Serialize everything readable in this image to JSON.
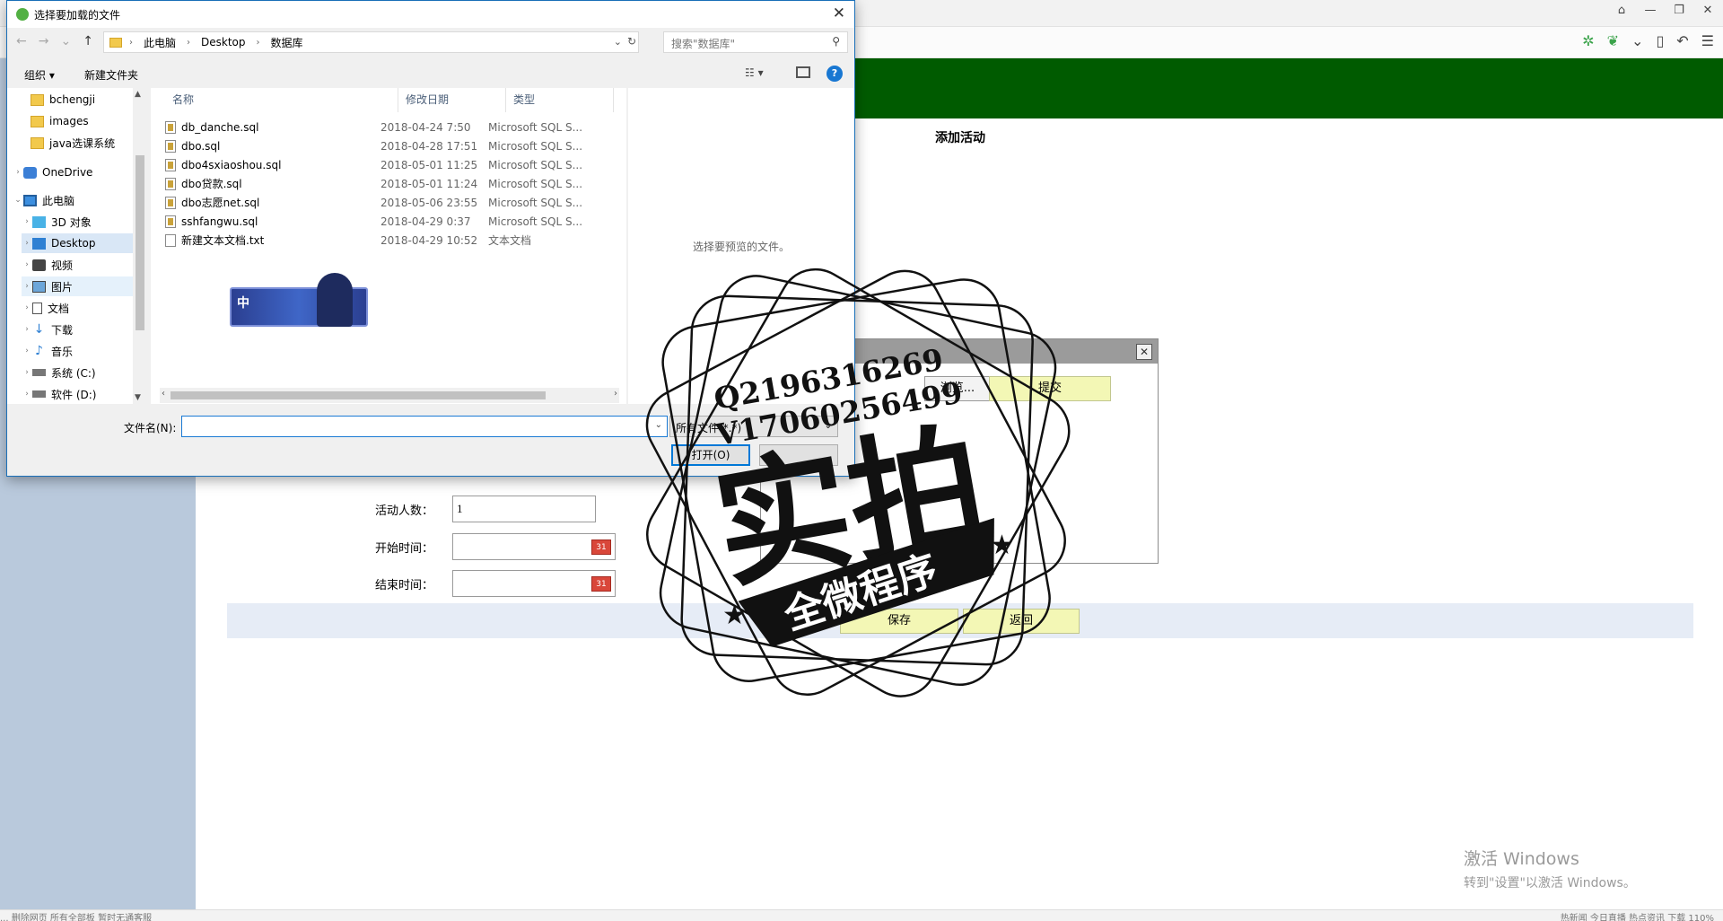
{
  "dialog": {
    "title": "选择要加载的文件",
    "breadcrumb": [
      "此电脑",
      "Desktop",
      "数据库"
    ],
    "search_placeholder": "搜索\"数据库\"",
    "organize_label": "组织 ▾",
    "new_folder_label": "新建文件夹",
    "nav_items": [
      {
        "label": "bchengji",
        "icon": "folder-icon"
      },
      {
        "label": "images",
        "icon": "folder-icon"
      },
      {
        "label": "java选课系统",
        "icon": "folder-icon"
      },
      {
        "label": "OneDrive",
        "icon": "onedrive-icon"
      },
      {
        "label": "此电脑",
        "icon": "computer-icon"
      },
      {
        "label": "3D 对象",
        "icon": "3d-objects-icon"
      },
      {
        "label": "Desktop",
        "icon": "desktop-icon"
      },
      {
        "label": "视频",
        "icon": "video-icon"
      },
      {
        "label": "图片",
        "icon": "pictures-icon"
      },
      {
        "label": "文档",
        "icon": "documents-icon"
      },
      {
        "label": "下载",
        "icon": "download-icon"
      },
      {
        "label": "音乐",
        "icon": "music-icon"
      },
      {
        "label": "系统 (C:)",
        "icon": "drive-icon"
      },
      {
        "label": "软件 (D:)",
        "icon": "drive-icon"
      }
    ],
    "columns": {
      "name": "名称",
      "date": "修改日期",
      "type": "类型"
    },
    "files": [
      {
        "name": "db_danche.sql",
        "date": "2018-04-24 7:50",
        "type": "Microsoft SQL S..."
      },
      {
        "name": "dbo.sql",
        "date": "2018-04-28 17:51",
        "type": "Microsoft SQL S..."
      },
      {
        "name": "dbo4sxiaoshou.sql",
        "date": "2018-05-01 11:25",
        "type": "Microsoft SQL S..."
      },
      {
        "name": "dbo贷款.sql",
        "date": "2018-05-01 11:24",
        "type": "Microsoft SQL S..."
      },
      {
        "name": "dbo志愿net.sql",
        "date": "2018-05-06 23:55",
        "type": "Microsoft SQL S..."
      },
      {
        "name": "sshfangwu.sql",
        "date": "2018-04-29 0:37",
        "type": "Microsoft SQL S..."
      },
      {
        "name": "新建文本文档.txt",
        "date": "2018-04-29 10:52",
        "type": "文本文档"
      }
    ],
    "preview_message": "选择要预览的文件。",
    "filename_label": "文件名(N):",
    "filename_value": "",
    "filetype_value": "所有文件(*.*)",
    "open_label": "打开(O)",
    "game_badge_text": "中"
  },
  "page": {
    "title": "添加活动",
    "fields": [
      {
        "label": "活动人数：",
        "value": "1"
      },
      {
        "label": "开始时间：",
        "value": ""
      },
      {
        "label": "结束时间：",
        "value": ""
      }
    ],
    "calendar_icon_text": "31",
    "upload": {
      "browse_label": "浏览...",
      "submit_label": "提交"
    },
    "save_label": "保存",
    "back_label": "返回",
    "activate": {
      "line1": "激活 Windows",
      "line2": "转到\"设置\"以激活 Windows。"
    },
    "status_left": "... 删除网页  所有全部板   暂时无通客服   ",
    "status_right": "热新闻   今日直播   热点资讯   下载   110%"
  },
  "watermark": {
    "contact1": "Q2196316269",
    "contact2": "V17060256499",
    "main": "实拍",
    "banner": "全微程序"
  }
}
